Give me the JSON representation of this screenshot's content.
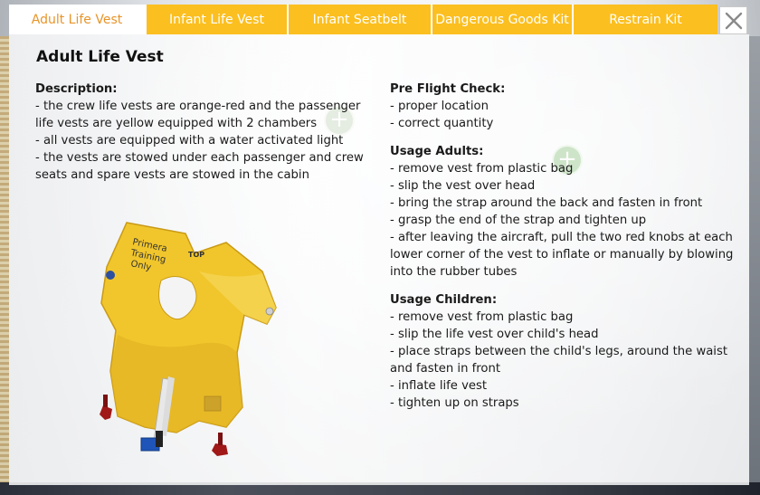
{
  "tabs": [
    {
      "label": "Adult Life Vest",
      "active": true
    },
    {
      "label": "Infant Life Vest",
      "active": false
    },
    {
      "label": "Infant Seatbelt",
      "active": false
    },
    {
      "label": "Dangerous Goods Kit",
      "active": false
    },
    {
      "label": "Restrain Kit",
      "active": false
    }
  ],
  "close_icon": "close-x-icon",
  "title": "Adult Life Vest",
  "description": {
    "heading": "Description:",
    "lines": [
      "- the crew life vests are orange-red and the passenger life vests are yellow equipped with 2 chambers",
      "- all vests are equipped with a water activated light",
      "- the vests are stowed under each passenger and crew seats and spare vests are stowed in the cabin"
    ]
  },
  "preflight": {
    "heading": "Pre Flight Check:",
    "lines": [
      "- proper location",
      "- correct quantity"
    ]
  },
  "usage_adults": {
    "heading": "Usage Adults:",
    "lines": [
      "- remove vest from plastic bag",
      "- slip the vest over head",
      "- bring the strap around the back and fasten in front",
      "- grasp the end of the strap and tighten up",
      "- after leaving the aircraft, pull the two red knobs at each lower corner of the vest to inflate or manually by blowing into the rubber tubes"
    ]
  },
  "usage_children": {
    "heading": "Usage Children:",
    "lines": [
      "- remove vest from plastic bag",
      "- slip the life vest over child's head",
      "- place straps between the child's legs, around the waist and fasten in front",
      "- inflate life vest",
      "- tighten up on straps"
    ]
  },
  "vest_image": {
    "handwriting": [
      "Primera",
      "Training",
      "Only"
    ],
    "label": "TOP"
  },
  "colors": {
    "tab_bg": "#fbbf20",
    "tab_active_text": "#e8952a",
    "vest_yellow": "#f1c62c",
    "knob_red": "#a01818"
  }
}
